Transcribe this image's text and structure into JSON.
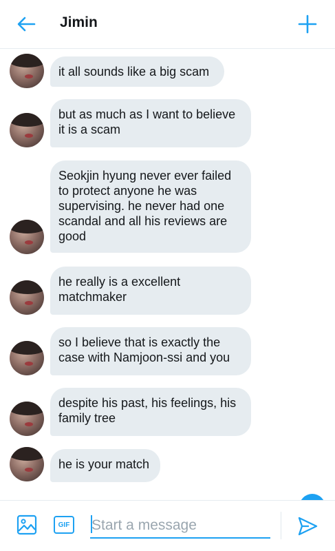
{
  "header": {
    "title": "Jimin",
    "back_icon": "arrow-left-icon",
    "new_icon": "plus-icon"
  },
  "colors": {
    "accent": "#1da1f2",
    "bubble": "#e6ecf0",
    "text": "#14171a"
  },
  "messages": [
    {
      "text": "it all sounds like a big scam"
    },
    {
      "text": "but as much as I want to believe\nit is a scam"
    },
    {
      "text": "Seokjin hyung never ever failed\nto protect anyone he was\nsupervising. he never had one\nscandal and all his reviews are\ngood"
    },
    {
      "text": "he really is a excellent\nmatchmaker"
    },
    {
      "text": "so I believe that is exactly the\ncase with Namjoon-ssi and you"
    },
    {
      "text": "despite his past, his feelings, his\nfamily tree"
    },
    {
      "text": "he is your match"
    }
  ],
  "composer": {
    "gif_label": "GIF",
    "placeholder": "Start a message",
    "value": ""
  }
}
